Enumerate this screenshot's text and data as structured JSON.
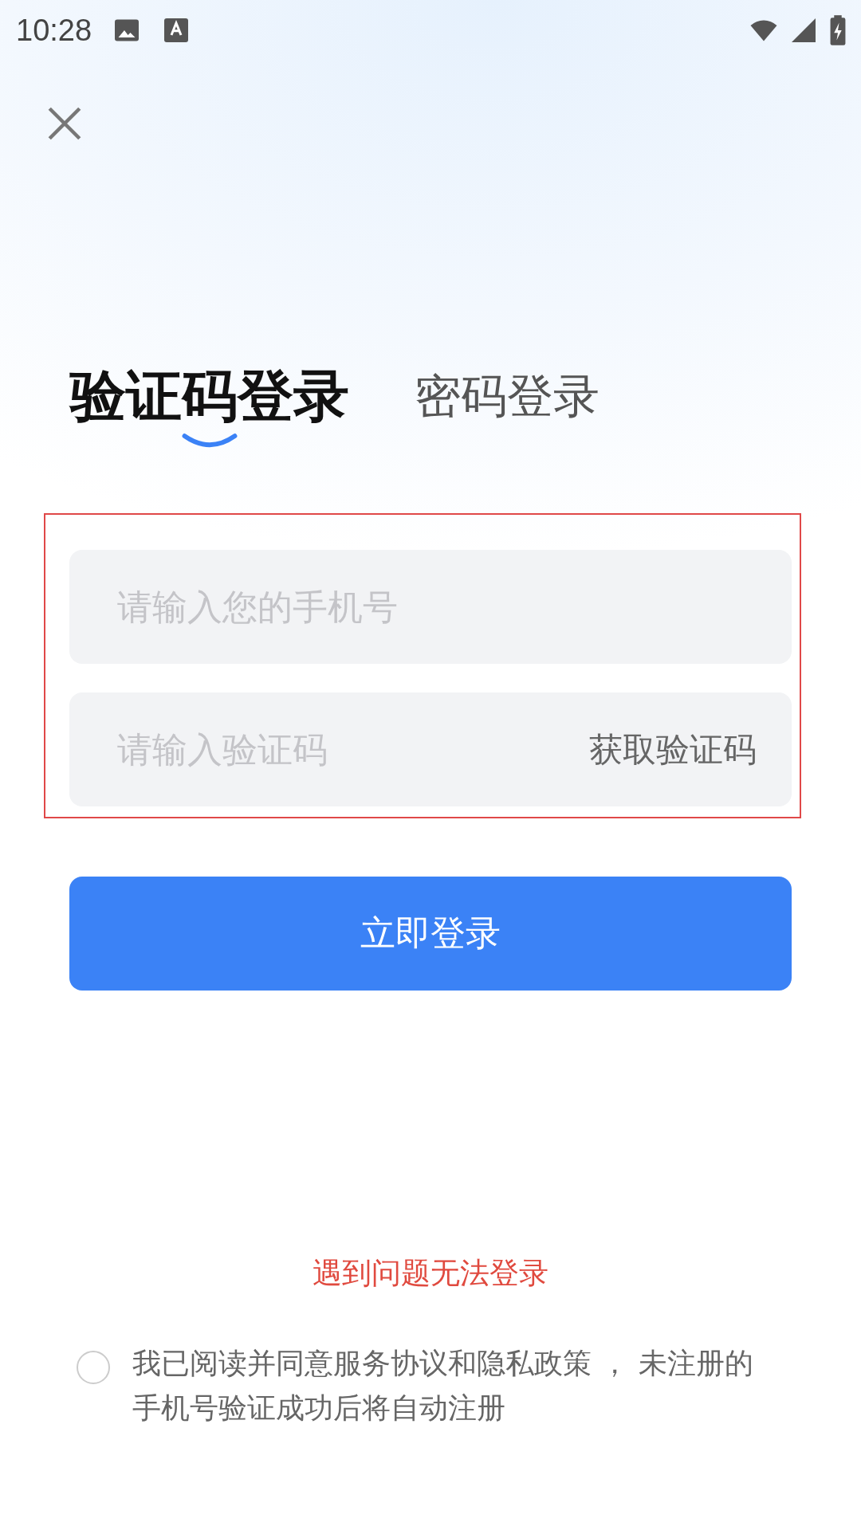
{
  "status_bar": {
    "time": "10:28"
  },
  "tabs": [
    {
      "label": "验证码登录",
      "selected": true
    },
    {
      "label": "密码登录",
      "selected": false
    }
  ],
  "fields": [
    {
      "placeholder": "请输入您的手机号"
    },
    {
      "placeholder": "请输入验证码",
      "action": "获取验证码"
    }
  ],
  "login_button": "立即登录",
  "help_link": "遇到问题无法登录",
  "agreement": {
    "checked": false,
    "text": "我已阅读并同意服务协议和隐私政策 ， 未注册的手机号验证成功后将自动注册"
  }
}
